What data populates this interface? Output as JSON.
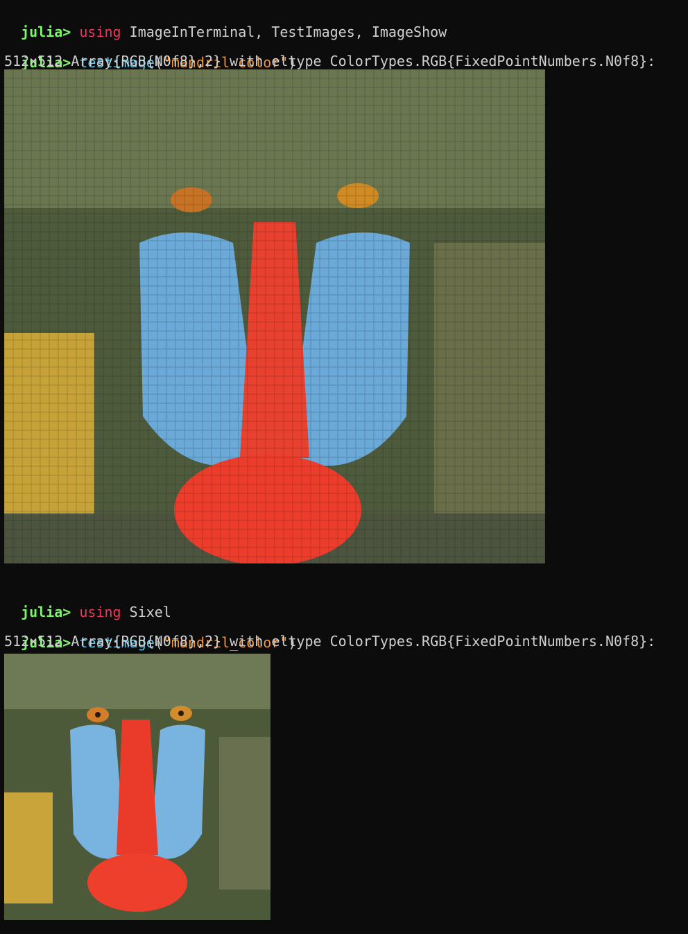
{
  "terminal": {
    "prompt": "julia>",
    "session1": {
      "cmd1": {
        "keyword": "using",
        "args": "ImageInTerminal, TestImages, ImageShow"
      },
      "cmd2": {
        "func": "testimage",
        "open_paren": "(",
        "arg": "\"mandril_color\"",
        "close_paren": ")"
      },
      "output": "512×512 Array{RGB{N0f8},2} with eltype ColorTypes.RGB{FixedPointNumbers.N0f8}:"
    },
    "session2": {
      "cmd1": {
        "keyword": "using",
        "args": "Sixel"
      },
      "cmd2": {
        "func": "testimage",
        "open_paren": "(",
        "arg": "\"mandril_color\"",
        "close_paren": ")"
      },
      "output": "512×512 Array{RGB{N0f8},2} with eltype ColorTypes.RGB{FixedPointNumbers.N0f8}:"
    }
  },
  "colors": {
    "background": "#0c0c0c",
    "prompt": "#7cf56b",
    "keyword": "#f0365c",
    "function": "#5ec8ef",
    "string": "#f2923a",
    "text": "#d0d0d0"
  }
}
